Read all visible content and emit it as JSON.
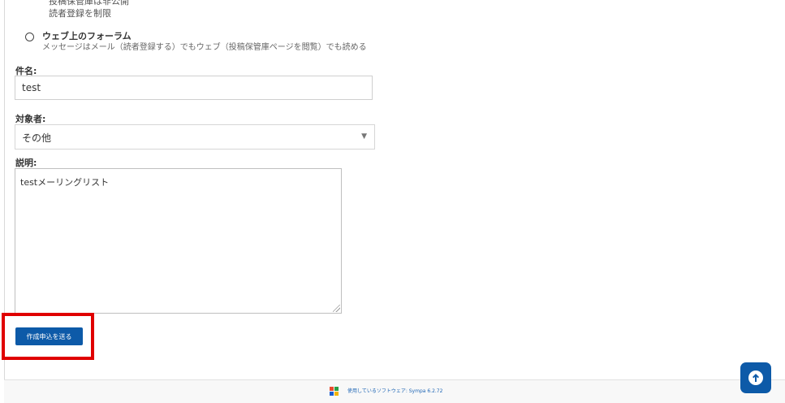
{
  "partial_list": {
    "line1": "投稿保管庫は非公開",
    "line2": "読者登録を制限"
  },
  "web_forum": {
    "title": "ウェブ上のフォーラム",
    "description": "メッセージはメール（読者登録する）でもウェブ（投稿保管庫ページを閲覧）でも読める"
  },
  "form": {
    "subject_label": "件名:",
    "subject_value": "test",
    "audience_label": "対象者:",
    "audience_value": "その他",
    "description_label": "説明:",
    "description_value": "testメーリングリスト",
    "submit_label": "作成申込を送る"
  },
  "footer": {
    "text": "使用しているソフトウェア: Sympa 6.2.72"
  },
  "icons": {
    "dropdown": "chevron-down-icon",
    "scroll_top": "arrow-up-circle-icon",
    "logo": "sympa-logo-icon"
  },
  "colors": {
    "primary": "#0d5aa8",
    "highlight": "#e00000",
    "footer_link": "#1f66b5"
  }
}
